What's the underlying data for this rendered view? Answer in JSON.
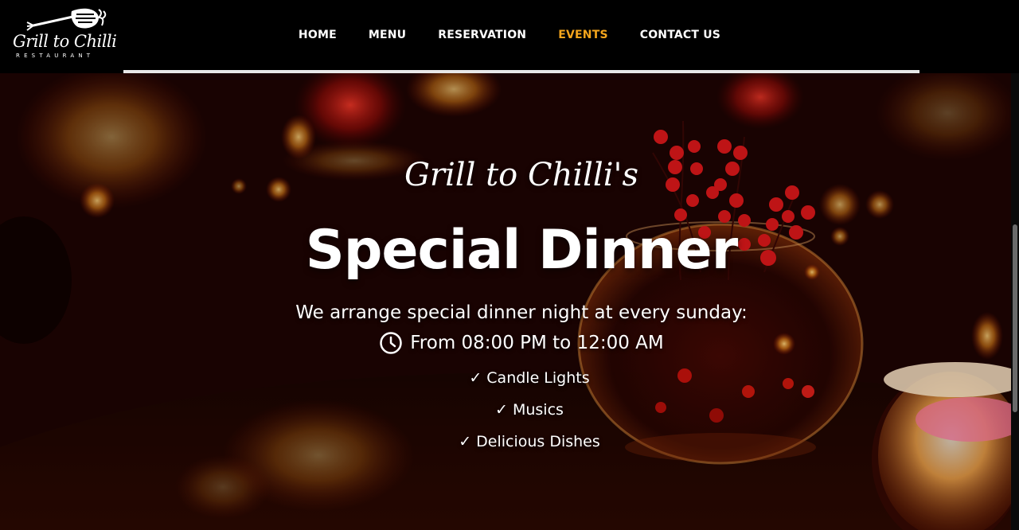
{
  "brand": {
    "name": "Grill to Chilli",
    "tagline": "RESTAURANT"
  },
  "nav": {
    "items": [
      {
        "label": "HOME",
        "active": false
      },
      {
        "label": "MENU",
        "active": false
      },
      {
        "label": "RESERVATION",
        "active": false
      },
      {
        "label": "EVENTS",
        "active": true
      },
      {
        "label": "CONTACT US",
        "active": false
      }
    ]
  },
  "hero": {
    "subtitle": "Grill to Chilli's",
    "title": "Special Dinner",
    "description": "We arrange special dinner night at every sunday:",
    "time_icon": "clock-icon",
    "time": "From 08:00 PM to 12:00 AM",
    "check_icon": "checkmark-icon",
    "features": [
      "Candle Lights",
      "Musics",
      "Delicious Dishes"
    ]
  },
  "colors": {
    "active_nav": "#f4a51c",
    "header_bg": "#000000",
    "text": "#ffffff"
  }
}
